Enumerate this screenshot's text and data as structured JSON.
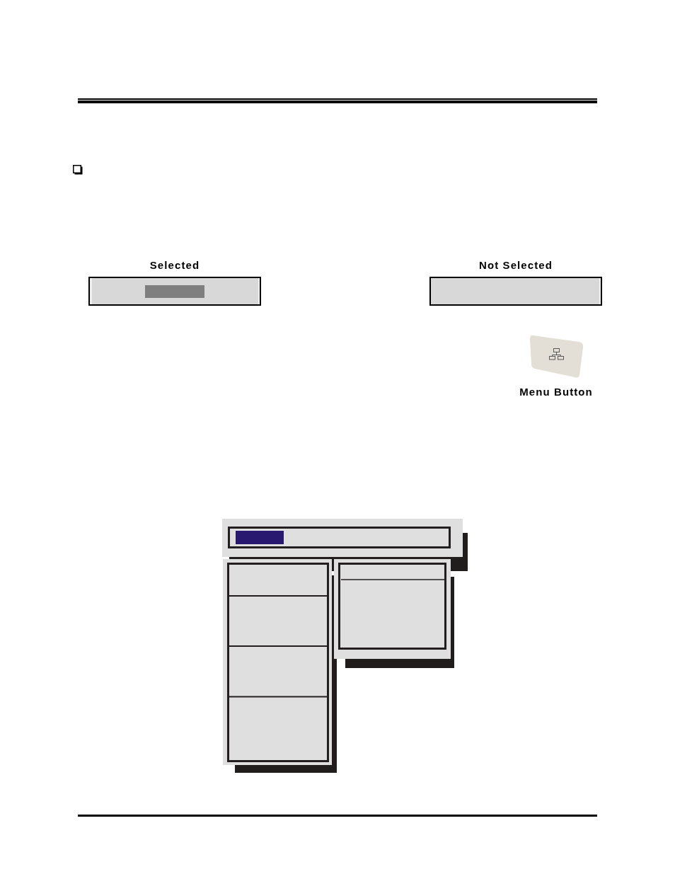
{
  "items": [
    {
      "caption": "Selected",
      "selected": true
    },
    {
      "caption": "Not Selected",
      "selected": false
    }
  ],
  "menu_button": {
    "caption": "Menu Button"
  },
  "menu_diagram": {
    "menu_bar_item": {
      "selected": true
    }
  }
}
